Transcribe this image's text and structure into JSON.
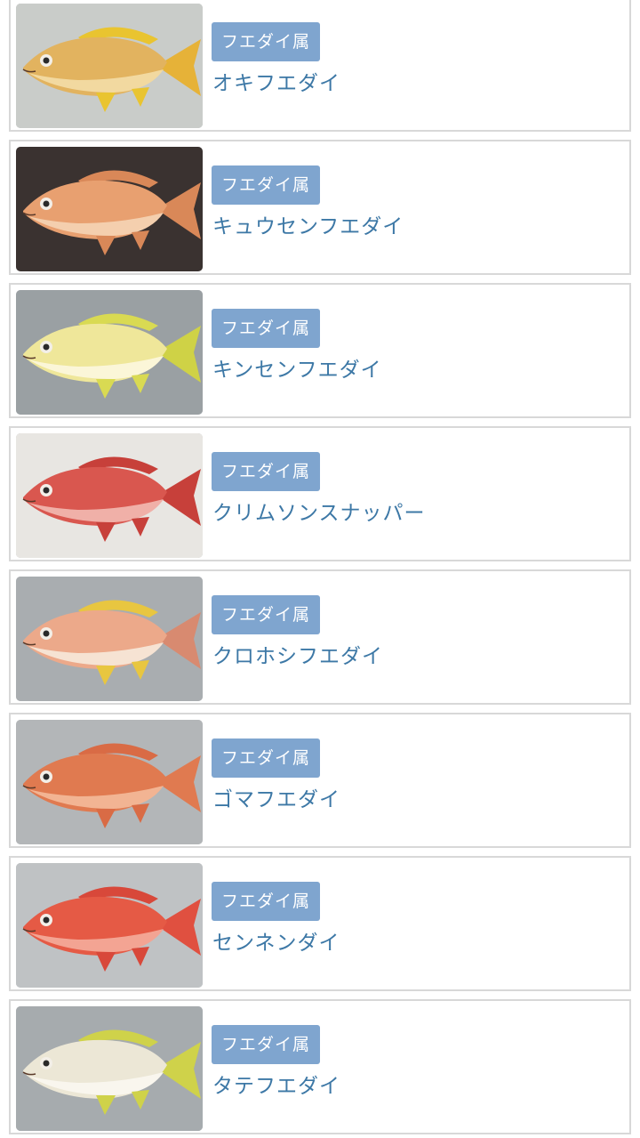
{
  "items": [
    {
      "genus": "フエダイ属",
      "name": "オキフエダイ",
      "photo": "fish-photo-okifuedai",
      "colors": {
        "bg": "#c9ccc9",
        "body": "#e2b35f",
        "belly": "#f2d9a0",
        "fin": "#e9c430",
        "tail": "#e6b238"
      }
    },
    {
      "genus": "フエダイ属",
      "name": "キュウセンフエダイ",
      "photo": "fish-photo-kyusenfuedai",
      "colors": {
        "bg": "#3a3230",
        "body": "#e8a070",
        "belly": "#f4cfae",
        "fin": "#d98858",
        "tail": "#d98858"
      }
    },
    {
      "genus": "フエダイ属",
      "name": "キンセンフエダイ",
      "photo": "fish-photo-kinsenfuedai",
      "colors": {
        "bg": "#9aa0a3",
        "body": "#efe79a",
        "belly": "#fbf6d8",
        "fin": "#d9da52",
        "tail": "#cfd246"
      }
    },
    {
      "genus": "フエダイ属",
      "name": "クリムソンスナッパー",
      "photo": "fish-photo-crimson-snapper",
      "colors": {
        "bg": "#e8e6e2",
        "body": "#d9574f",
        "belly": "#f0b0a8",
        "fin": "#c7403a",
        "tail": "#c7403a"
      }
    },
    {
      "genus": "フエダイ属",
      "name": "クロホシフエダイ",
      "photo": "fish-photo-kurohoshifuedai",
      "colors": {
        "bg": "#a9adb0",
        "body": "#eca98a",
        "belly": "#f6e3d3",
        "fin": "#e8c640",
        "tail": "#d88a70"
      }
    },
    {
      "genus": "フエダイ属",
      "name": "ゴマフエダイ",
      "photo": "fish-photo-gomafuedai",
      "colors": {
        "bg": "#b3b6b8",
        "body": "#e07a50",
        "belly": "#f2b493",
        "fin": "#d96b45",
        "tail": "#e07a50"
      }
    },
    {
      "genus": "フエダイ属",
      "name": "センネンダイ",
      "photo": "fish-photo-sennendai",
      "colors": {
        "bg": "#bfc2c4",
        "body": "#e55a45",
        "belly": "#f3a493",
        "fin": "#d8483a",
        "tail": "#e05040"
      }
    },
    {
      "genus": "フエダイ属",
      "name": "タテフエダイ",
      "photo": "fish-photo-tatefuedai",
      "colors": {
        "bg": "#a6abae",
        "body": "#ece7d6",
        "belly": "#f9f6ee",
        "fin": "#cfd24a",
        "tail": "#cfd24a"
      }
    }
  ]
}
